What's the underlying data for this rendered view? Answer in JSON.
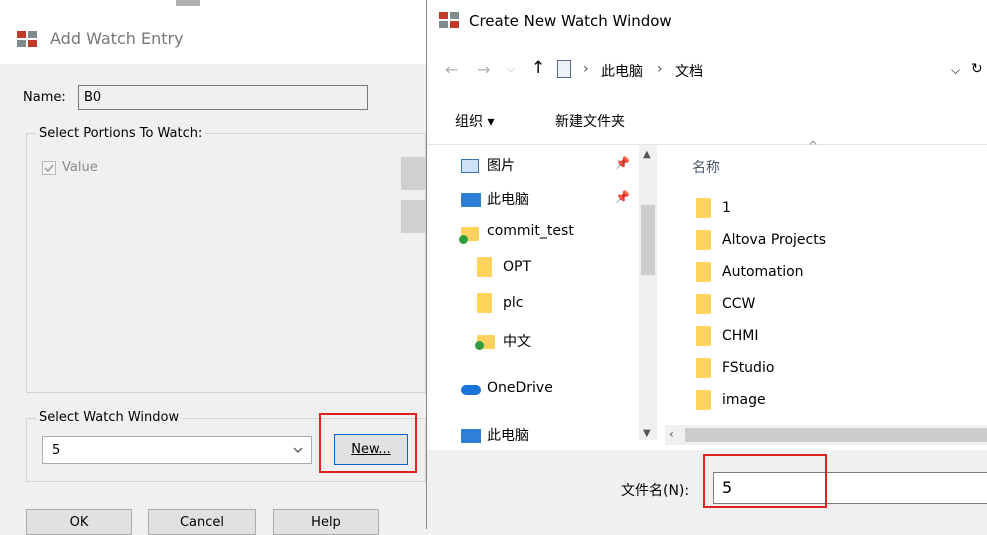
{
  "left_dialog": {
    "title": "Add Watch Entry",
    "name_label": "Name:",
    "name_value": "B0",
    "portions_group_label": "Select Portions To Watch:",
    "value_checkbox_label": "Value",
    "watch_window_group_label": "Select Watch Window",
    "watch_window_selected": "5",
    "new_button_label": "New...",
    "ok_button_label": "OK",
    "cancel_button_label": "Cancel",
    "help_button_label": "Help"
  },
  "right_dialog": {
    "title": "Create New Watch Window",
    "breadcrumb": [
      "此电脑",
      "文档"
    ],
    "toolbar": {
      "organize_label": "组织 ▾",
      "new_folder_label": "新建文件夹"
    },
    "nav_items": [
      {
        "label": "图片",
        "icon": "pictures-icon",
        "pinned": true
      },
      {
        "label": "此电脑",
        "icon": "computer-icon",
        "pinned": true
      },
      {
        "label": "commit_test",
        "icon": "folder-sync-icon",
        "pinned": false
      },
      {
        "label": "OPT",
        "icon": "folder-icon",
        "pinned": false
      },
      {
        "label": "plc",
        "icon": "folder-icon",
        "pinned": false
      },
      {
        "label": "中文",
        "icon": "folder-sync-icon",
        "pinned": false
      },
      {
        "label": "OneDrive",
        "icon": "onedrive-cloud-icon",
        "pinned": false
      },
      {
        "label": "此电脑",
        "icon": "computer-icon",
        "pinned": false
      }
    ],
    "column_header": "名称",
    "files": [
      "1",
      "Altova Projects",
      "Automation",
      "CCW",
      "CHMI",
      "FStudio",
      "image"
    ],
    "filename_label": "文件名(N):",
    "filename_value": "5"
  },
  "colors": {
    "highlight_red": "#e02020",
    "folder_yellow": "#ffd35c",
    "accent_blue": "#0a64c8"
  }
}
